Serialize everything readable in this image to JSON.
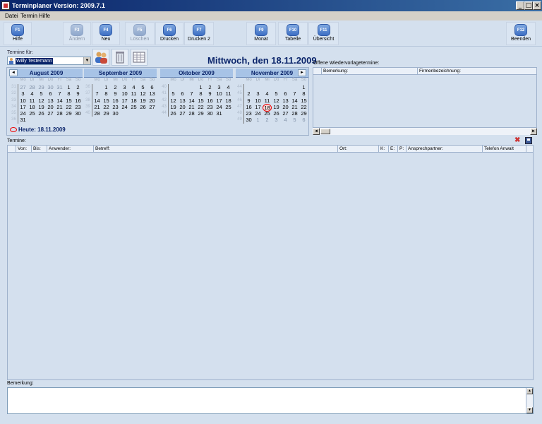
{
  "window": {
    "title": "Terminplaner Version: 2009.7.1",
    "min": "_",
    "max": "□",
    "close": "×"
  },
  "menu": [
    "Datei",
    "Termin",
    "Hilfe"
  ],
  "toolbar": [
    {
      "key": "F1",
      "label": "Hilfe",
      "enabled": true
    },
    {
      "key": "F3",
      "label": "Ändern",
      "enabled": false
    },
    {
      "key": "F4",
      "label": "Neu",
      "enabled": true
    },
    {
      "key": "F5",
      "label": "Löschen",
      "enabled": false
    },
    {
      "key": "F6",
      "label": "Drucken",
      "enabled": true
    },
    {
      "key": "F7",
      "label": "Drucken 2",
      "enabled": true
    },
    {
      "key": "F9",
      "label": "Monat",
      "enabled": true
    },
    {
      "key": "F10",
      "label": "Tabelle",
      "enabled": true
    },
    {
      "key": "F11",
      "label": "Übersicht",
      "enabled": true
    },
    {
      "key": "F12",
      "label": "Beenden",
      "enabled": true
    }
  ],
  "termine_fuer": {
    "label": "Termine für:",
    "user": "Willy Testemann"
  },
  "date_heading": "Mittwoch, den 18.11.2009",
  "weekday_headers": [
    "Mo",
    "Di",
    "Mi",
    "Do",
    "Fr",
    "Sa",
    "So"
  ],
  "nav": {
    "prev": "◄",
    "next": "►"
  },
  "months": [
    {
      "title": "August 2009",
      "weeks": [
        {
          "wn": "31",
          "days": [
            [
              "27",
              1
            ],
            [
              "28",
              1
            ],
            [
              "29",
              1
            ],
            [
              "30",
              1
            ],
            [
              "31",
              1
            ],
            [
              "1",
              0
            ],
            [
              "2",
              0
            ]
          ]
        },
        {
          "wn": "32",
          "days": [
            [
              "3",
              0
            ],
            [
              "4",
              0
            ],
            [
              "5",
              0
            ],
            [
              "6",
              0
            ],
            [
              "7",
              0
            ],
            [
              "8",
              0
            ],
            [
              "9",
              0
            ]
          ]
        },
        {
          "wn": "33",
          "days": [
            [
              "10",
              0
            ],
            [
              "11",
              0
            ],
            [
              "12",
              0
            ],
            [
              "13",
              0
            ],
            [
              "14",
              0
            ],
            [
              "15",
              0
            ],
            [
              "16",
              0
            ]
          ]
        },
        {
          "wn": "34",
          "days": [
            [
              "17",
              0
            ],
            [
              "18",
              0
            ],
            [
              "19",
              0
            ],
            [
              "20",
              0
            ],
            [
              "21",
              0
            ],
            [
              "22",
              0
            ],
            [
              "23",
              0
            ]
          ]
        },
        {
          "wn": "35",
          "days": [
            [
              "24",
              0
            ],
            [
              "25",
              0
            ],
            [
              "26",
              0
            ],
            [
              "27",
              0
            ],
            [
              "28",
              0
            ],
            [
              "29",
              0
            ],
            [
              "30",
              0
            ]
          ]
        },
        {
          "wn": "36",
          "days": [
            [
              "31",
              0
            ],
            [
              "",
              0
            ],
            [
              "",
              0
            ],
            [
              "",
              0
            ],
            [
              "",
              0
            ],
            [
              "",
              0
            ],
            [
              "",
              0
            ]
          ]
        }
      ]
    },
    {
      "title": "September 2009",
      "weeks": [
        {
          "wn": "36",
          "days": [
            [
              "",
              0
            ],
            [
              "1",
              0
            ],
            [
              "2",
              0
            ],
            [
              "3",
              0
            ],
            [
              "4",
              0
            ],
            [
              "5",
              0
            ],
            [
              "6",
              0
            ]
          ]
        },
        {
          "wn": "37",
          "days": [
            [
              "7",
              0
            ],
            [
              "8",
              0
            ],
            [
              "9",
              0
            ],
            [
              "10",
              0
            ],
            [
              "11",
              0
            ],
            [
              "12",
              0
            ],
            [
              "13",
              0
            ]
          ]
        },
        {
          "wn": "38",
          "days": [
            [
              "14",
              0
            ],
            [
              "15",
              0
            ],
            [
              "16",
              0
            ],
            [
              "17",
              0
            ],
            [
              "18",
              0
            ],
            [
              "19",
              0
            ],
            [
              "20",
              0
            ]
          ]
        },
        {
          "wn": "39",
          "days": [
            [
              "21",
              0
            ],
            [
              "22",
              0
            ],
            [
              "23",
              0
            ],
            [
              "24",
              0
            ],
            [
              "25",
              0
            ],
            [
              "26",
              0
            ],
            [
              "27",
              0
            ]
          ]
        },
        {
          "wn": "40",
          "days": [
            [
              "28",
              0
            ],
            [
              "29",
              0
            ],
            [
              "30",
              0
            ],
            [
              "",
              0
            ],
            [
              "",
              0
            ],
            [
              "",
              0
            ],
            [
              "",
              0
            ]
          ]
        }
      ]
    },
    {
      "title": "Oktober 2009",
      "weeks": [
        {
          "wn": "40",
          "days": [
            [
              "",
              0
            ],
            [
              "",
              0
            ],
            [
              "",
              0
            ],
            [
              "1",
              0
            ],
            [
              "2",
              0
            ],
            [
              "3",
              0
            ],
            [
              "4",
              0
            ]
          ]
        },
        {
          "wn": "41",
          "days": [
            [
              "5",
              0
            ],
            [
              "6",
              0
            ],
            [
              "7",
              0
            ],
            [
              "8",
              0
            ],
            [
              "9",
              0
            ],
            [
              "10",
              0
            ],
            [
              "11",
              0
            ]
          ]
        },
        {
          "wn": "42",
          "days": [
            [
              "12",
              0
            ],
            [
              "13",
              0
            ],
            [
              "14",
              0
            ],
            [
              "15",
              0
            ],
            [
              "16",
              0
            ],
            [
              "17",
              0
            ],
            [
              "18",
              0
            ]
          ]
        },
        {
          "wn": "43",
          "days": [
            [
              "19",
              0
            ],
            [
              "20",
              0
            ],
            [
              "21",
              0
            ],
            [
              "22",
              0
            ],
            [
              "23",
              0
            ],
            [
              "24",
              0
            ],
            [
              "25",
              0
            ]
          ]
        },
        {
          "wn": "44",
          "days": [
            [
              "26",
              0
            ],
            [
              "27",
              0
            ],
            [
              "28",
              0
            ],
            [
              "29",
              0
            ],
            [
              "30",
              0
            ],
            [
              "31",
              0
            ],
            [
              "",
              0
            ]
          ]
        }
      ]
    },
    {
      "title": "November 2009",
      "weeks": [
        {
          "wn": "44",
          "days": [
            [
              "",
              0
            ],
            [
              "",
              0
            ],
            [
              "",
              0
            ],
            [
              "",
              0
            ],
            [
              "",
              0
            ],
            [
              "",
              0
            ],
            [
              "1",
              0
            ]
          ]
        },
        {
          "wn": "45",
          "days": [
            [
              "2",
              0
            ],
            [
              "3",
              0
            ],
            [
              "4",
              0
            ],
            [
              "5",
              0
            ],
            [
              "6",
              0
            ],
            [
              "7",
              0
            ],
            [
              "8",
              0
            ]
          ]
        },
        {
          "wn": "46",
          "days": [
            [
              "9",
              0
            ],
            [
              "10",
              0
            ],
            [
              "11",
              0
            ],
            [
              "12",
              0
            ],
            [
              "13",
              0
            ],
            [
              "14",
              0
            ],
            [
              "15",
              0
            ]
          ]
        },
        {
          "wn": "47",
          "days": [
            [
              "16",
              0
            ],
            [
              "17",
              0
            ],
            [
              "18",
              2
            ],
            [
              "19",
              0
            ],
            [
              "20",
              0
            ],
            [
              "21",
              0
            ],
            [
              "22",
              0
            ]
          ]
        },
        {
          "wn": "48",
          "days": [
            [
              "23",
              0
            ],
            [
              "24",
              0
            ],
            [
              "25",
              0
            ],
            [
              "26",
              0
            ],
            [
              "27",
              0
            ],
            [
              "28",
              0
            ],
            [
              "29",
              0
            ]
          ]
        },
        {
          "wn": "49",
          "days": [
            [
              "30",
              0
            ],
            [
              "1",
              1
            ],
            [
              "2",
              1
            ],
            [
              "3",
              1
            ],
            [
              "4",
              1
            ],
            [
              "5",
              1
            ],
            [
              "6",
              1
            ]
          ]
        }
      ]
    }
  ],
  "heute": "Heute: 18.11.2009",
  "wiedervorlage": {
    "label": "Offene Wiedervorlagetermine:",
    "columns": [
      "Bemerkung:",
      "Firmenbezeichnung:"
    ],
    "scroll_left": "◄",
    "scroll_right": "►"
  },
  "termine": {
    "label": "Termine:",
    "columns": [
      "Von:",
      "Bis:",
      "Anwender:",
      "Betreff:",
      "Ort:",
      "K:",
      "E:",
      "P:",
      "Ansprechpartner:",
      "Telefon Anwalt"
    ],
    "delete_icon": "✖"
  },
  "bemerkung": {
    "label": "Bemerkung:",
    "scroll_up": "▲",
    "scroll_down": "▼"
  }
}
